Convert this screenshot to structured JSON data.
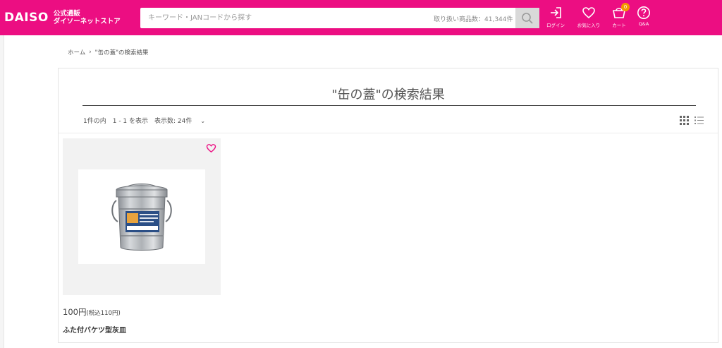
{
  "header": {
    "logo_main": "DAISO",
    "logo_sub_line1": "公式通販",
    "logo_sub_line2": "ダイソーネットストア",
    "search_placeholder": "キーワード・JANコードから探す",
    "item_count": "取り扱い商品数：41,344件",
    "nav": {
      "login": "ログイン",
      "favorites": "お気に入り",
      "cart": "カート",
      "cart_count": "0",
      "qa": "Q&A"
    },
    "colors": {
      "brand": "#ec0e82",
      "badge": "#f39800"
    }
  },
  "breadcrumb": {
    "home": "ホーム",
    "separator": "›",
    "current": "\"缶の蓋\"の検索結果"
  },
  "results": {
    "title": "\"缶の蓋\"の検索結果",
    "count_text": "1件の内",
    "range_text": "1 - 1 を表示",
    "per_page_text": "表示数: 24件",
    "per_page_chevron": "⌄",
    "view_modes": [
      "grid-icon",
      "list-icon"
    ]
  },
  "products": [
    {
      "price": "100円",
      "tax_price": "(税込110円)",
      "name": "ふた付バケツ型灰皿"
    }
  ]
}
